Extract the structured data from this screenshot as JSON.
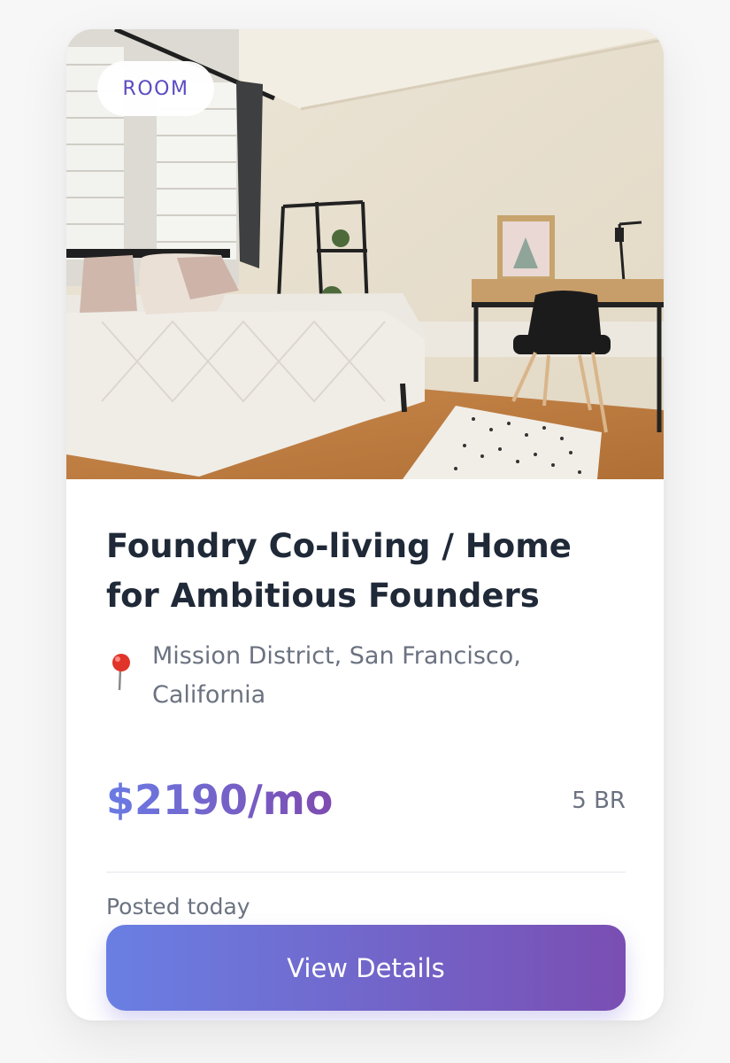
{
  "listing": {
    "badge": "ROOM",
    "title": "Foundry Co-living / Home for Ambitious Founders",
    "location": "Mission District, San Francisco, California",
    "location_icon": "pushpin-icon",
    "price": "$2190/mo",
    "bedrooms": "5 BR",
    "posted": "Posted today",
    "cta_label": "View Details"
  },
  "colors": {
    "accent_start": "#6a7fe3",
    "accent_end": "#7a4eb3",
    "badge_text": "#5a4bc2",
    "title": "#1f2937",
    "muted": "#6b7280"
  }
}
